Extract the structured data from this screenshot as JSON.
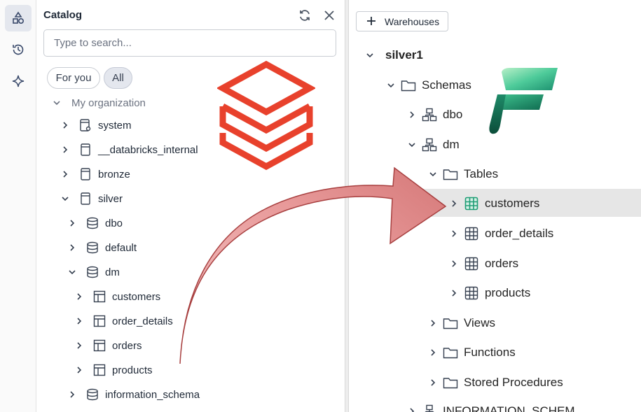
{
  "catalog": {
    "title": "Catalog",
    "search_placeholder": "Type to search...",
    "filters": {
      "for_you": "For you",
      "all": "All"
    },
    "org_label": "My organization",
    "items": [
      {
        "label": "system"
      },
      {
        "label": "__databricks_internal"
      },
      {
        "label": "bronze"
      },
      {
        "label": "silver"
      },
      {
        "label": "dbo"
      },
      {
        "label": "default"
      },
      {
        "label": "dm"
      },
      {
        "label": "customers"
      },
      {
        "label": "order_details"
      },
      {
        "label": "orders"
      },
      {
        "label": "products"
      },
      {
        "label": "information_schema"
      }
    ]
  },
  "fabric": {
    "warehouses_button": "Warehouses",
    "items": [
      {
        "label": "silver1"
      },
      {
        "label": "Schemas"
      },
      {
        "label": "dbo"
      },
      {
        "label": "dm"
      },
      {
        "label": "Tables"
      },
      {
        "label": "customers"
      },
      {
        "label": "order_details"
      },
      {
        "label": "orders"
      },
      {
        "label": "products"
      },
      {
        "label": "Views"
      },
      {
        "label": "Functions"
      },
      {
        "label": "Stored Procedures"
      },
      {
        "label": "INFORMATION_SCHEM"
      }
    ]
  },
  "colors": {
    "databricks_red": "#e8412c",
    "arrow_fill": "#e8a0a0",
    "arrow_stroke": "#a84040",
    "fabric_green": "#1f9d75",
    "selected_row_bg": "#e6e6e6"
  },
  "icons": [
    "catalog-icon",
    "history-icon",
    "assistant-icon",
    "refresh-icon",
    "close-icon",
    "chevron-right-icon",
    "chevron-down-icon",
    "database-icon",
    "schema-icon",
    "table-icon",
    "folder-icon",
    "plus-icon",
    "databricks-logo",
    "fabric-logo"
  ]
}
